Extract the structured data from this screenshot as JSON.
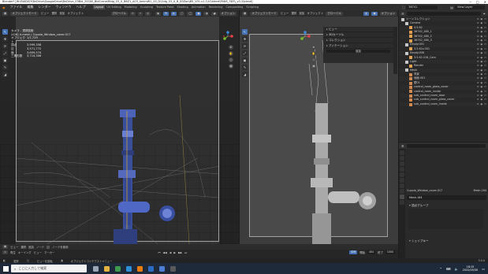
{
  "window": {
    "title": "Blender* [W:\\RAID0\\Y\\BnDrive\\GoogleDrive\\BnDrive_03Bld_20000_BldCrane\\Bldg_03_X_B6Z1_A03_AmimW1_00_D\\1ldg_03_X_B_B3Zon\\B5_V01-v1.1\\V1blend\\PANS_3D5\\_v1\\1\\blend]",
    "controls": [
      "─",
      "□",
      "✕"
    ]
  },
  "menu": {
    "items": [
      "ファイル",
      "編集",
      "レンダー",
      "ウィンドウ",
      "ヘルプ"
    ],
    "workspaces": [
      "Layout",
      "UV Editing",
      "Modeling",
      "Sculpting",
      "Texture Paint",
      "Shading",
      "Animation",
      "Rendering",
      "Compositing",
      "Scripting"
    ],
    "active_workspace": "Layout",
    "scene": "36741",
    "view_layer": "View Layer"
  },
  "left_viewport": {
    "header": {
      "mode": "オブジェクトモード",
      "menus": [
        "ビュー",
        "選択",
        "追加",
        "オブジェクト"
      ],
      "orientation": "グローバル",
      "options": "オプション"
    },
    "overlay_title": "カメラ - 透視投影",
    "overlay_subtitle": "(426) 4.mesh | Cupola_Window_cover.017",
    "stats": [
      {
        "label": "オブジェクト",
        "value": "1/1,729"
      },
      {
        "label": "頂点",
        "value": "3,999,358"
      },
      {
        "label": "辺",
        "value": "3,571,772"
      },
      {
        "label": "面",
        "value": "3,609,574"
      },
      {
        "label": "三角形数",
        "value": "3,714,306"
      }
    ],
    "tools": [
      "↖",
      "✥",
      "⟳",
      "⤢",
      "▣",
      "✎",
      "◢"
    ]
  },
  "right_viewport": {
    "header": {
      "mode": "オブジェクトモード",
      "menus": [
        "ビュー",
        "選択",
        "追加",
        "オブジェクト"
      ],
      "orientation": "グローバル",
      "options": "オプション"
    },
    "n_panel": {
      "sections": [
        "ビュー",
        "3Dカーソル",
        "コレクション",
        "アノテーション"
      ],
      "field": "追加"
    },
    "tools": [
      "↖",
      "✥",
      "⟳",
      "⤢",
      "▣",
      "✎",
      "◢"
    ]
  },
  "outliner": {
    "search_placeholder": "",
    "items": [
      {
        "name": "シーンコレクション",
        "indent": 0,
        "color": "#c8c8c8"
      },
      {
        "name": "Camera",
        "indent": 1,
        "color": "#c8c8c8"
      },
      {
        "name": "3.5.62",
        "indent": 2,
        "color": "#e0a050"
      },
      {
        "name": "36742_480_1",
        "indent": 2,
        "color": "#e0a050"
      },
      {
        "name": "36742_480_2",
        "indent": 2,
        "color": "#e0a050"
      },
      {
        "name": "36742_480_3",
        "indent": 2,
        "color": "#e0a050"
      },
      {
        "name": "Empty.001",
        "indent": 1,
        "color": "#c8c8c8"
      },
      {
        "name": "3.5.62v.001",
        "indent": 2,
        "color": "#e0a050"
      },
      {
        "name": "Empty.008",
        "indent": 1,
        "color": "#c8c8c8"
      },
      {
        "name": "3.5.62.018_Cam",
        "indent": 2,
        "color": "#e0a050"
      },
      {
        "name": "Light",
        "indent": 1,
        "color": "#c8c8c8"
      },
      {
        "name": "Render",
        "indent": 2,
        "color": "#e0a050"
      },
      {
        "name": "Mesh",
        "indent": 1,
        "color": "#c8c8c8"
      },
      {
        "name": "背景",
        "indent": 2,
        "color": "#d08a50"
      },
      {
        "name": "地面.001",
        "indent": 2,
        "color": "#d08a50"
      },
      {
        "name": "壁01",
        "indent": 2,
        "color": "#d08a50"
      },
      {
        "name": "control_room_glass_cover",
        "indent": 2,
        "color": "#d08a50"
      },
      {
        "name": "control_room_inside",
        "indent": 2,
        "color": "#d08a50"
      },
      {
        "name": "sub_control_room_door",
        "indent": 2,
        "color": "#d08a50"
      },
      {
        "name": "sub_control_room_glass_cover",
        "indent": 2,
        "color": "#d08a50"
      },
      {
        "name": "sub_control_room_inside",
        "indent": 2,
        "color": "#d08a50"
      }
    ],
    "vis_icons": [
      "⊘",
      "◉",
      "▭"
    ]
  },
  "properties": {
    "object_name": "Cupola_Window_cover.017",
    "mesh_data": "Mesh.164",
    "data_field": "Mesh.164",
    "panels": [
      "頂点グループ",
      "シェイプキー"
    ]
  },
  "timeline": {
    "menus": [
      "再生",
      "キーイング",
      "ビュー",
      "マーカー"
    ],
    "current_frame": "426",
    "start_label": "開始",
    "start": "404",
    "end_label": "終了",
    "end": "1000",
    "transport": [
      "⏮",
      "◀◀",
      "◀",
      "▶",
      "▶▶",
      "⏭"
    ]
  },
  "left_bottom_header": {
    "menus": [
      "ビュー",
      "選択",
      "追加",
      "ノード"
    ],
    "use_nodes": "ノードを使用"
  },
  "status_bar": {
    "left": "選択",
    "middle": "ビューを回転",
    "right": "オブジェクトコンテクストメニュー",
    "version": "3.0.0"
  },
  "taskbar": {
    "search_placeholder": "ここに入力して検索",
    "apps": [
      {
        "name": "task-view",
        "color": "#9aa6b8"
      },
      {
        "name": "explorer",
        "color": "#e3b341"
      },
      {
        "name": "chrome",
        "color": "#3d9a4f"
      },
      {
        "name": "edge",
        "color": "#2e8fd6"
      },
      {
        "name": "blender",
        "color": "#e87d0d"
      },
      {
        "name": "mail",
        "color": "#2a6cc4"
      },
      {
        "name": "store",
        "color": "#4a7fd4"
      },
      {
        "name": "terminal",
        "color": "#5a5a5a"
      }
    ],
    "time": "18:15",
    "date": "2022/05/30"
  },
  "colors": {
    "accent": "#4772b3",
    "axis_x": "#e0424b",
    "axis_y": "#7cbc2f",
    "axis_z": "#3f8ad8",
    "highlight": "#e87d0d"
  }
}
